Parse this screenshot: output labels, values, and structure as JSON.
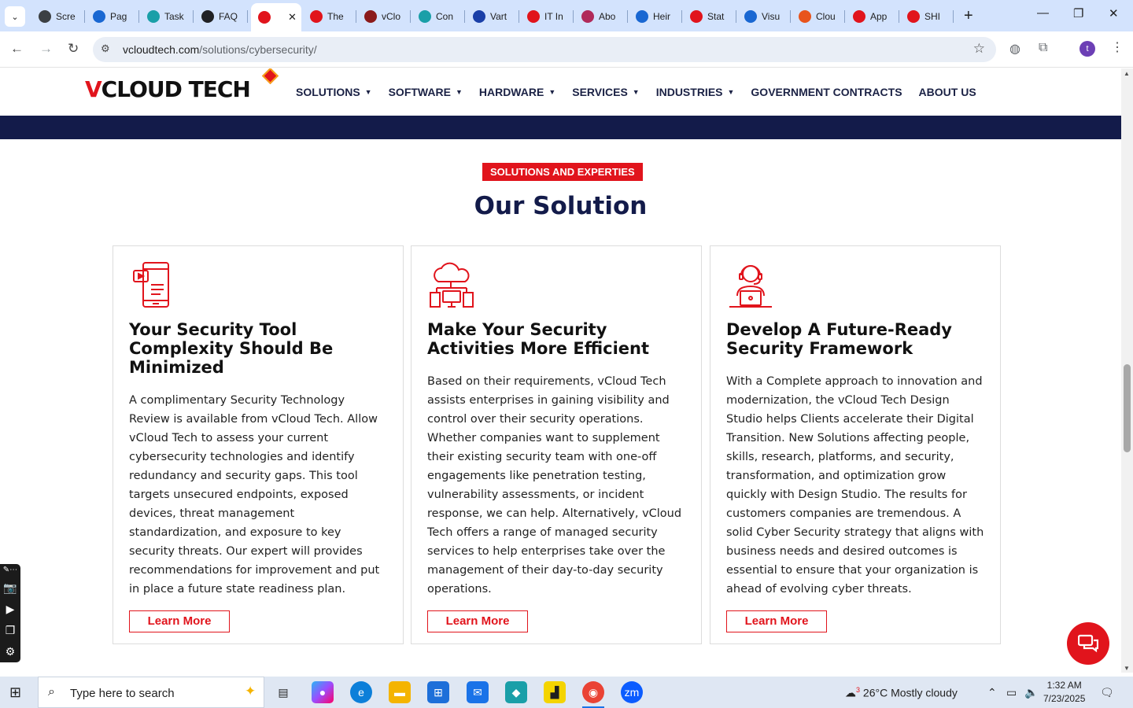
{
  "browser": {
    "tabs": [
      {
        "label": "Scre",
        "color": "#3c4043",
        "icon": "screen-icon"
      },
      {
        "label": "Pag",
        "color": "#1967d2",
        "icon": "wifi-icon"
      },
      {
        "label": "Task",
        "color": "#1a9fa8",
        "icon": "task-icon"
      },
      {
        "label": "FAQ",
        "color": "#202124",
        "icon": "openai-icon"
      },
      {
        "label": "",
        "color": "#e1141c",
        "icon": "vcloud-icon",
        "active": true
      },
      {
        "label": "The",
        "color": "#e1141c",
        "icon": "vcloud-icon"
      },
      {
        "label": "vClo",
        "color": "#8b1a1a",
        "icon": "v-icon"
      },
      {
        "label": "Con",
        "color": "#1a9fa8",
        "icon": "task-icon"
      },
      {
        "label": "Vart",
        "color": "#1a3fa8",
        "icon": "x-icon"
      },
      {
        "label": "IT In",
        "color": "#e1141c",
        "icon": "vcloud-icon"
      },
      {
        "label": "Abo",
        "color": "#b02a5a",
        "icon": "abo-icon"
      },
      {
        "label": "Heir",
        "color": "#1967d2",
        "icon": "scale-icon"
      },
      {
        "label": "Stat",
        "color": "#e1141c",
        "icon": "stat-icon"
      },
      {
        "label": "Visu",
        "color": "#1967d2",
        "icon": "pulse-icon"
      },
      {
        "label": "Clou",
        "color": "#e8541c",
        "icon": "cloud-icon"
      },
      {
        "label": "App",
        "color": "#e1141c",
        "icon": "vcloud-icon"
      },
      {
        "label": "SHI",
        "color": "#e1141c",
        "icon": "shi-icon"
      }
    ],
    "url_host": "vcloudtech.com",
    "url_path": "/solutions/cybersecurity/",
    "avatar_letter": "t"
  },
  "site": {
    "logo": {
      "v": "V",
      "rest": "CLOUD TECH"
    },
    "nav": [
      {
        "label": "SOLUTIONS",
        "caret": true
      },
      {
        "label": "SOFTWARE",
        "caret": true
      },
      {
        "label": "HARDWARE",
        "caret": true
      },
      {
        "label": "SERVICES",
        "caret": true
      },
      {
        "label": "INDUSTRIES",
        "caret": true
      },
      {
        "label": "GOVERNMENT CONTRACTS",
        "caret": false
      },
      {
        "label": "ABOUT US",
        "caret": false
      }
    ],
    "badge": "SOLUTIONS AND EXPERTIES",
    "section_title": "Our Solution",
    "cards": [
      {
        "title": "Your Security Tool Complexity Should Be Minimized",
        "body": "A complimentary Security Technology Review is available from vCloud Tech. Allow vCloud Tech to assess your current cybersecurity technologies and identify redundancy and security gaps. This tool targets unsecured endpoints, exposed devices, threat management standardization, and exposure to key security threats. Our expert will provides recommendations for improvement and put in place a future state readiness plan.",
        "button": "Learn More",
        "icon": "mobile-video-icon"
      },
      {
        "title": "Make Your Security Activities More Efficient",
        "body": "Based on their requirements, vCloud Tech assists enterprises in gaining visibility and control over their security operations. Whether companies want to supplement their existing security team with one-off engagements like penetration testing, vulnerability assessments, or incident response, we can help. Alternatively, vCloud Tech offers a range of managed security services to help enterprises take over the management of their day-to-day security operations.",
        "button": "Learn More",
        "icon": "cloud-network-icon"
      },
      {
        "title": "Develop A Future-Ready Security Framework",
        "body": "With a Complete approach to innovation and modernization, the vCloud Tech Design Studio helps Clients accelerate their Digital Transition. New Solutions affecting people, skills, research, platforms, and security, transformation, and optimization grow quickly with Design Studio. The results for customers companies are tremendous. A solid Cyber Security strategy that aligns with business needs and desired outcomes is essential to ensure that your organization is ahead of evolving cyber threats.",
        "button": "Learn More",
        "icon": "support-agent-icon"
      }
    ],
    "accent_color": "#e1141c",
    "navy_color": "#131b4a"
  },
  "taskbar": {
    "search_placeholder": "Type here to search",
    "weather": "26°C  Mostly cloudy",
    "weather_badge": "3",
    "time": "1:32 AM",
    "date": "7/23/2025"
  }
}
